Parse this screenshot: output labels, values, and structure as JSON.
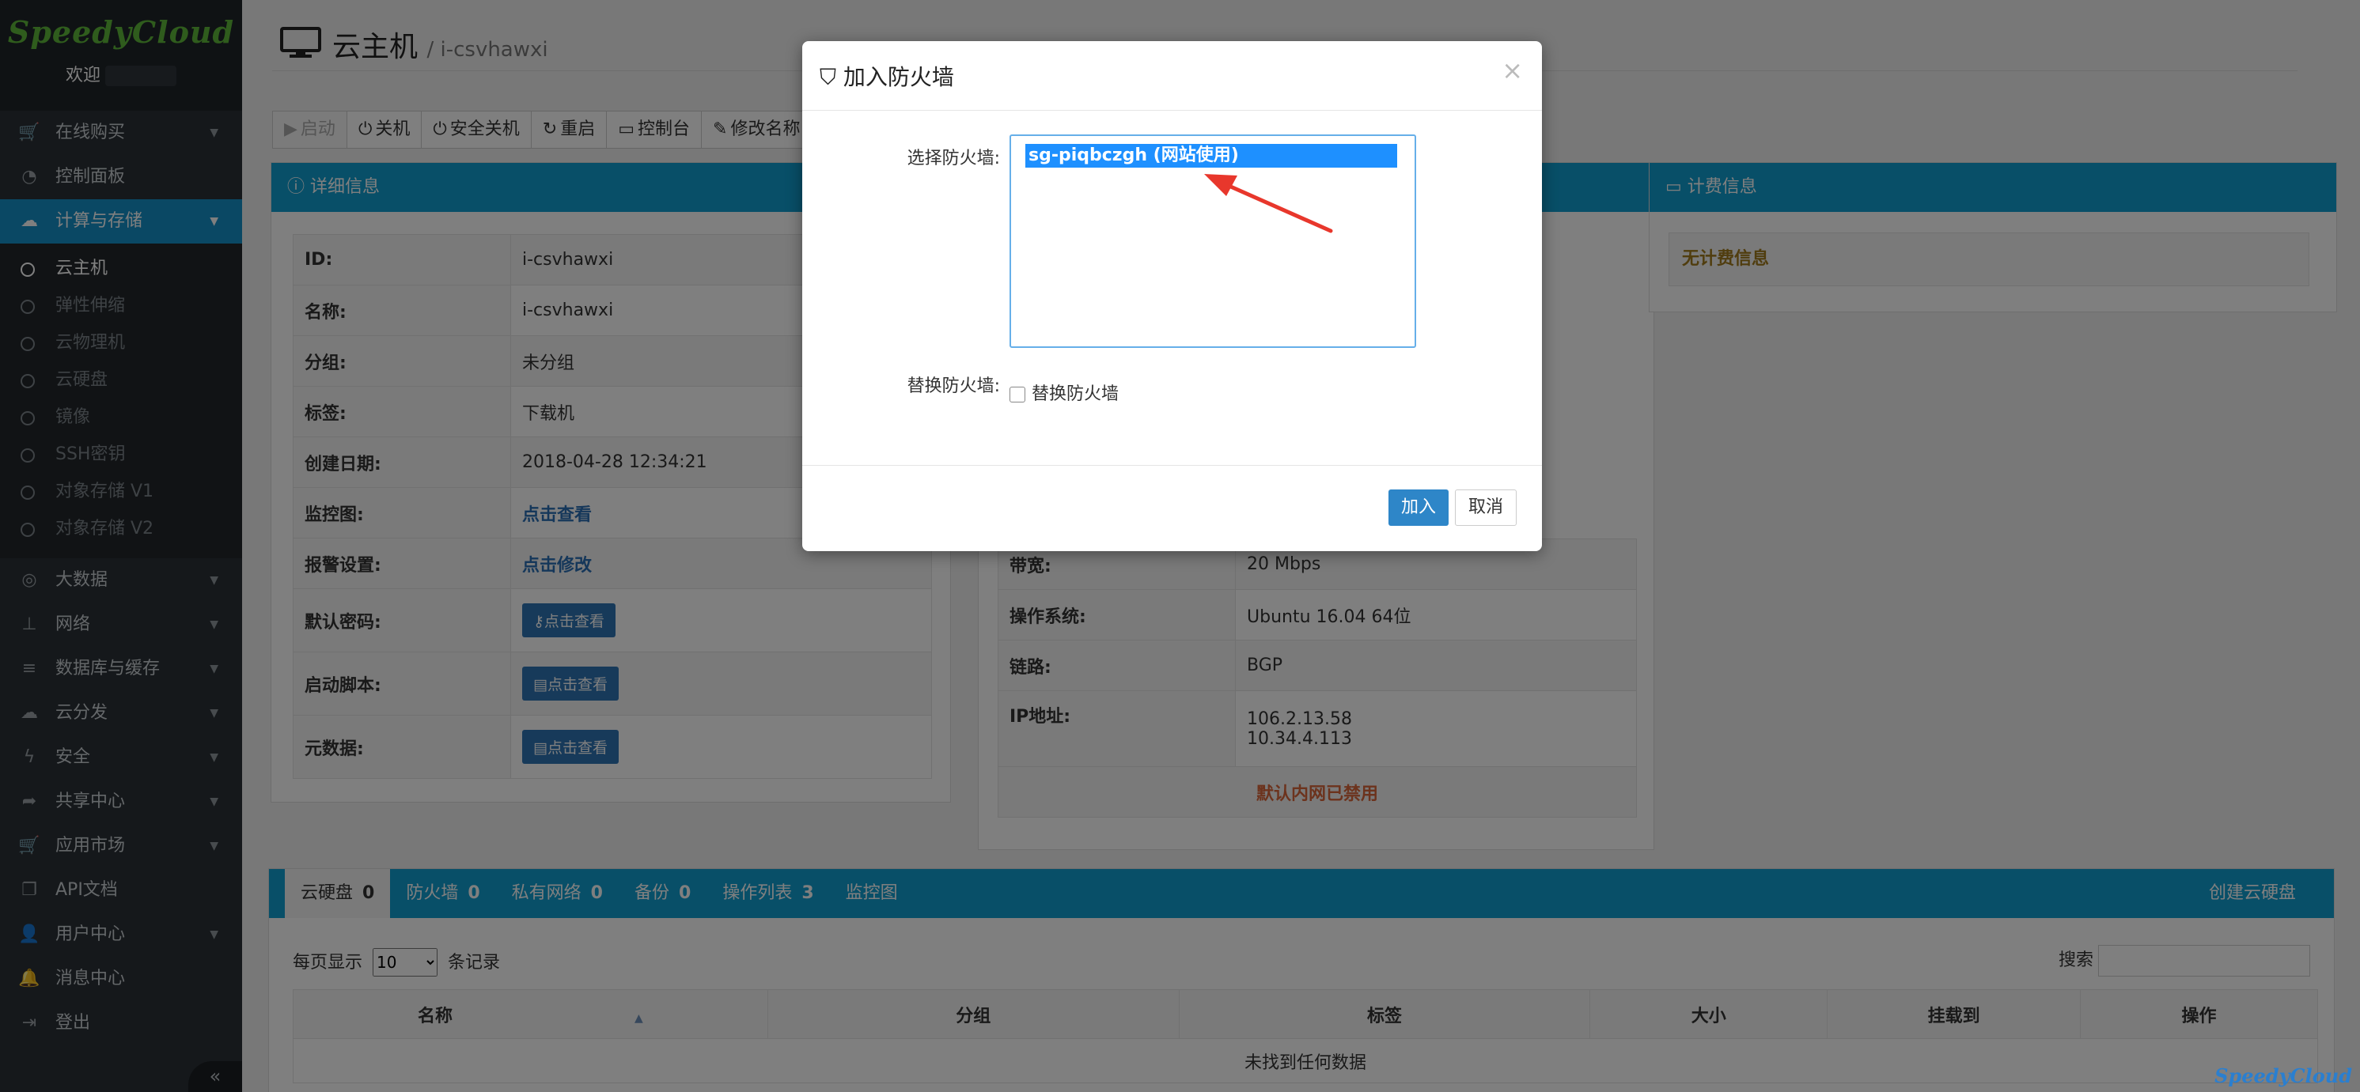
{
  "sidebar": {
    "brand": "SpeedyCloud",
    "welcome": "欢迎",
    "items_top": [
      {
        "label": "在线购买",
        "icon": "cart-icon"
      },
      {
        "label": "控制面板",
        "icon": "dashboard-icon"
      },
      {
        "label": "计算与存储",
        "icon": "cloud-icon"
      }
    ],
    "subitems": [
      "云主机",
      "弹性伸缩",
      "云物理机",
      "云硬盘",
      "镜像",
      "SSH密钥",
      "对象存储 V1",
      "对象存储 V2"
    ],
    "items_bottom": [
      {
        "label": "大数据"
      },
      {
        "label": "网络"
      },
      {
        "label": "数据库与缓存"
      },
      {
        "label": "云分发"
      },
      {
        "label": "安全"
      },
      {
        "label": "共享中心"
      },
      {
        "label": "应用市场"
      },
      {
        "label": "API文档"
      },
      {
        "label": "用户中心"
      },
      {
        "label": "消息中心"
      },
      {
        "label": "登出"
      }
    ],
    "collapse": "«"
  },
  "header": {
    "title": "云主机",
    "subtitle": "/ i-csvhawxi"
  },
  "toolbar": [
    "启动",
    "关机",
    "安全关机",
    "重启",
    "控制台",
    "修改名称"
  ],
  "detail": {
    "title": "详细信息",
    "rows": [
      {
        "k": "ID:",
        "v": "i-csvhawxi"
      },
      {
        "k": "名称:",
        "v": "i-csvhawxi"
      },
      {
        "k": "分组:",
        "v": "未分组"
      },
      {
        "k": "标签:",
        "v": "下载机"
      },
      {
        "k": "创建日期:",
        "v": "2018-04-28 12:34:21"
      },
      {
        "k": "监控图:",
        "v": "点击查看"
      },
      {
        "k": "报警设置:",
        "v": "点击修改"
      },
      {
        "k": "默认密码:",
        "v": "点击查看"
      },
      {
        "k": "启动脚本:",
        "v": "点击查看"
      },
      {
        "k": "元数据:",
        "v": "点击查看"
      }
    ]
  },
  "mid": {
    "rows": [
      {
        "k": "带宽:",
        "v": "20 Mbps"
      },
      {
        "k": "操作系统:",
        "v": "Ubuntu 16.04 64位"
      },
      {
        "k": "链路:",
        "v": "BGP"
      },
      {
        "k": "IP地址:",
        "v": "106.2.13.58",
        "v2": "10.34.4.113"
      }
    ],
    "warning": "默认内网已禁用"
  },
  "billing": {
    "title": "计费信息",
    "empty": "无计费信息"
  },
  "tabs": [
    {
      "label": "云硬盘",
      "count": "0"
    },
    {
      "label": "防火墙",
      "count": "0"
    },
    {
      "label": "私有网络",
      "count": "0"
    },
    {
      "label": "备份",
      "count": "0"
    },
    {
      "label": "操作列表",
      "count": "3"
    },
    {
      "label": "监控图",
      "count": ""
    }
  ],
  "create_disk": "创建云硬盘",
  "table": {
    "length_prefix": "每页显示",
    "length_value": "10",
    "length_suffix": "条记录",
    "search_label": "搜索",
    "columns": [
      "名称",
      "分组",
      "标签",
      "大小",
      "挂载到",
      "操作"
    ],
    "empty": "未找到任何数据"
  },
  "modal": {
    "title": "加入防火墙",
    "select_label": "选择防火墙:",
    "option": "sg-piqbczgh (网站使用)",
    "replace_label": "替换防火墙:",
    "replace_check_label": "替换防火墙",
    "add": "加入",
    "cancel": "取消",
    "close": "×"
  },
  "watermark": "SpeedyCloud",
  "colors": {
    "accent": "#119fd0",
    "sidebar": "#2b3137",
    "active_nav": "#1590c9",
    "arrow": "#e8372c"
  }
}
